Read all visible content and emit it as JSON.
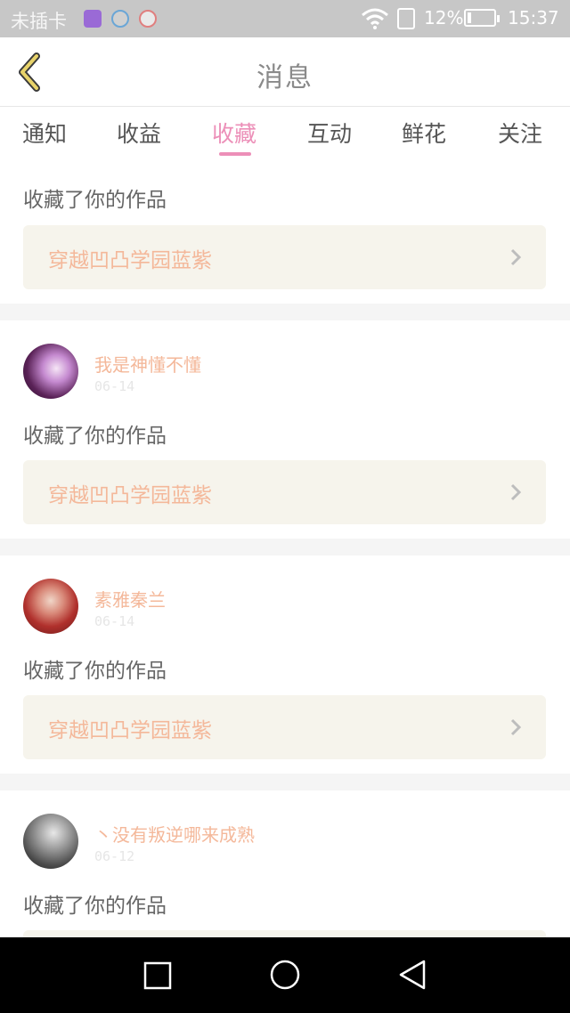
{
  "status_bar": {
    "carrier": "未插卡",
    "battery_pct": "12%",
    "battery_level": 0.12,
    "time": "15:37",
    "icons": [
      "gallery-icon",
      "app-icon",
      "app-a-icon",
      "wifi-icon",
      "sim-icon",
      "battery-icon"
    ]
  },
  "header": {
    "title": "消息",
    "back_icon": "chevron-left-icon",
    "accent": "#c9b13a"
  },
  "tabs": {
    "items": [
      {
        "label": "通知"
      },
      {
        "label": "收益"
      },
      {
        "label": "收藏"
      },
      {
        "label": "互动"
      },
      {
        "label": "鲜花"
      },
      {
        "label": "关注"
      }
    ],
    "active_index": 2,
    "active_color": "#ec8fb8"
  },
  "feed": {
    "items": [
      {
        "action": "收藏了你的作品",
        "work_title": "穿越凹凸学园蓝紫"
      },
      {
        "username": "我是神懂不懂",
        "date": "06-14",
        "action": "收藏了你的作品",
        "work_title": "穿越凹凸学园蓝紫"
      },
      {
        "username": "素雅秦兰",
        "date": "06-14",
        "action": "收藏了你的作品",
        "work_title": "穿越凹凸学园蓝紫"
      },
      {
        "username": "丶没有叛逆哪来成熟",
        "date": "06-12",
        "action": "收藏了你的作品"
      }
    ]
  },
  "navbar": {
    "icons": [
      "recent-apps-icon",
      "home-icon",
      "back-icon"
    ]
  }
}
